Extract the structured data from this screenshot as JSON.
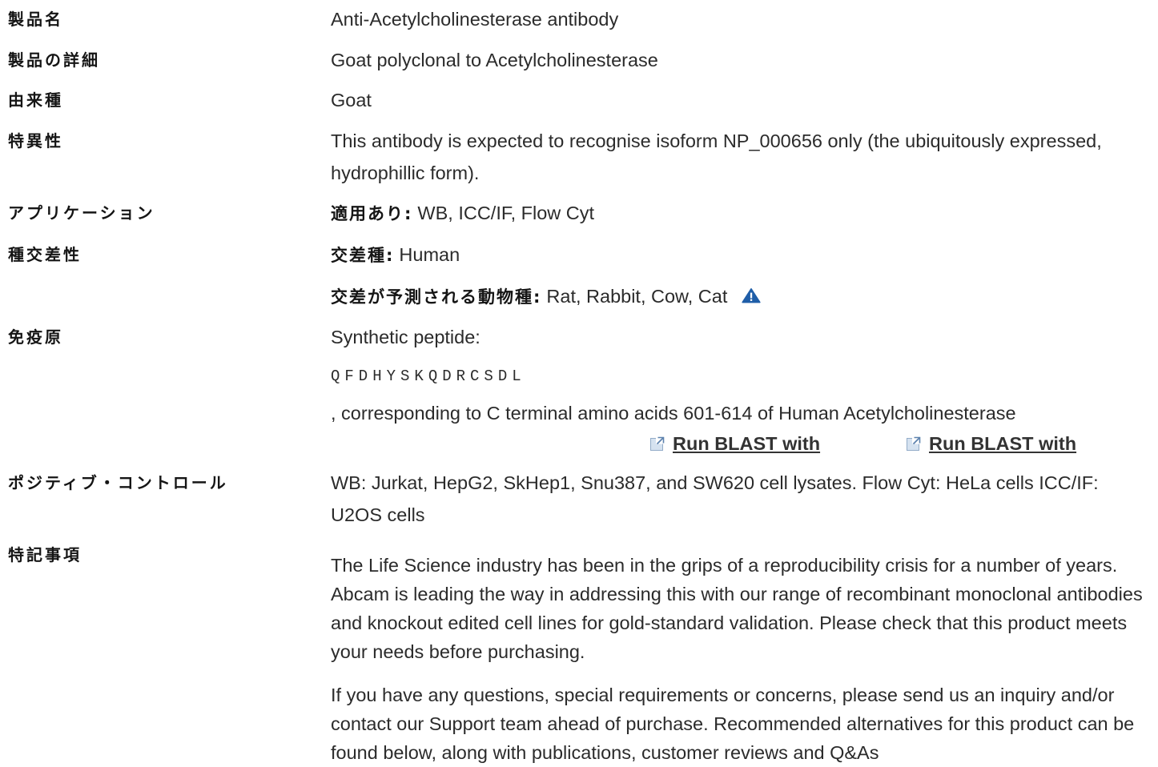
{
  "colors": {
    "text": "#2b2b2b",
    "label": "#151515",
    "link": "#333333",
    "warning_icon": "#1f5ea8",
    "link_icon_fill": "#d5e2f0",
    "link_icon_stroke": "#93acc8",
    "link_icon_arrow": "#5d82ae"
  },
  "product_name": {
    "label": "製品名",
    "value": "Anti-Acetylcholinesterase antibody"
  },
  "description": {
    "label": "製品の詳細",
    "value": "Goat polyclonal to Acetylcholinesterase"
  },
  "host_species": {
    "label": "由来種",
    "value": "Goat"
  },
  "specificity": {
    "label": "特異性",
    "lines": [
      "This antibody is expected to recognise isoform NP_000656 only (the ubiquitously expressed,",
      "hydrophillic form)."
    ]
  },
  "applications": {
    "label": "アプリケーション",
    "prefix": "適用あり:",
    "value": "WB, ICC/IF, Flow Cyt"
  },
  "reactivity": {
    "label": "種交差性",
    "tested_prefix": "交差種:",
    "tested_value": "Human",
    "predicted_prefix": "交差が予測される動物種:",
    "predicted_value": "Rat, Rabbit, Cow, Cat",
    "predicted_icon": "warning-triangle-icon"
  },
  "immunogen": {
    "label": "免疫原",
    "intro": "Synthetic peptide:",
    "sequence": "QFDHYSKQDRCSDL",
    "description": ", corresponding to C terminal amino acids 601-614 of Human Acetylcholinesterase",
    "blast_links": [
      {
        "icon": "external-link-icon",
        "label": "Run BLAST with"
      },
      {
        "icon": "external-link-icon",
        "label": "Run BLAST with"
      }
    ]
  },
  "positive_control": {
    "label": "ポジティブ・コントロール",
    "lines": [
      "WB: Jurkat, HepG2, SkHep1, Snu387, and SW620 cell lysates. Flow Cyt: HeLa cells ICC/IF:",
      "U2OS cells"
    ]
  },
  "general_notes": {
    "label": "特記事項",
    "paragraphs": [
      {
        "lines": [
          "The Life Science industry has been in the grips of a reproducibility crisis for a number of years.",
          "Abcam is leading the way in addressing this with our range of recombinant monoclonal antibodies",
          "and knockout edited cell lines for gold-standard validation. Please check that this product meets",
          "your needs before purchasing."
        ]
      },
      {
        "lines": [
          "If you have any questions, special requirements or concerns, please send us an inquiry and/or",
          "contact our Support team ahead of purchase. Recommended alternatives for this product can be",
          "found below, along with publications, customer reviews and Q&As"
        ]
      }
    ]
  }
}
